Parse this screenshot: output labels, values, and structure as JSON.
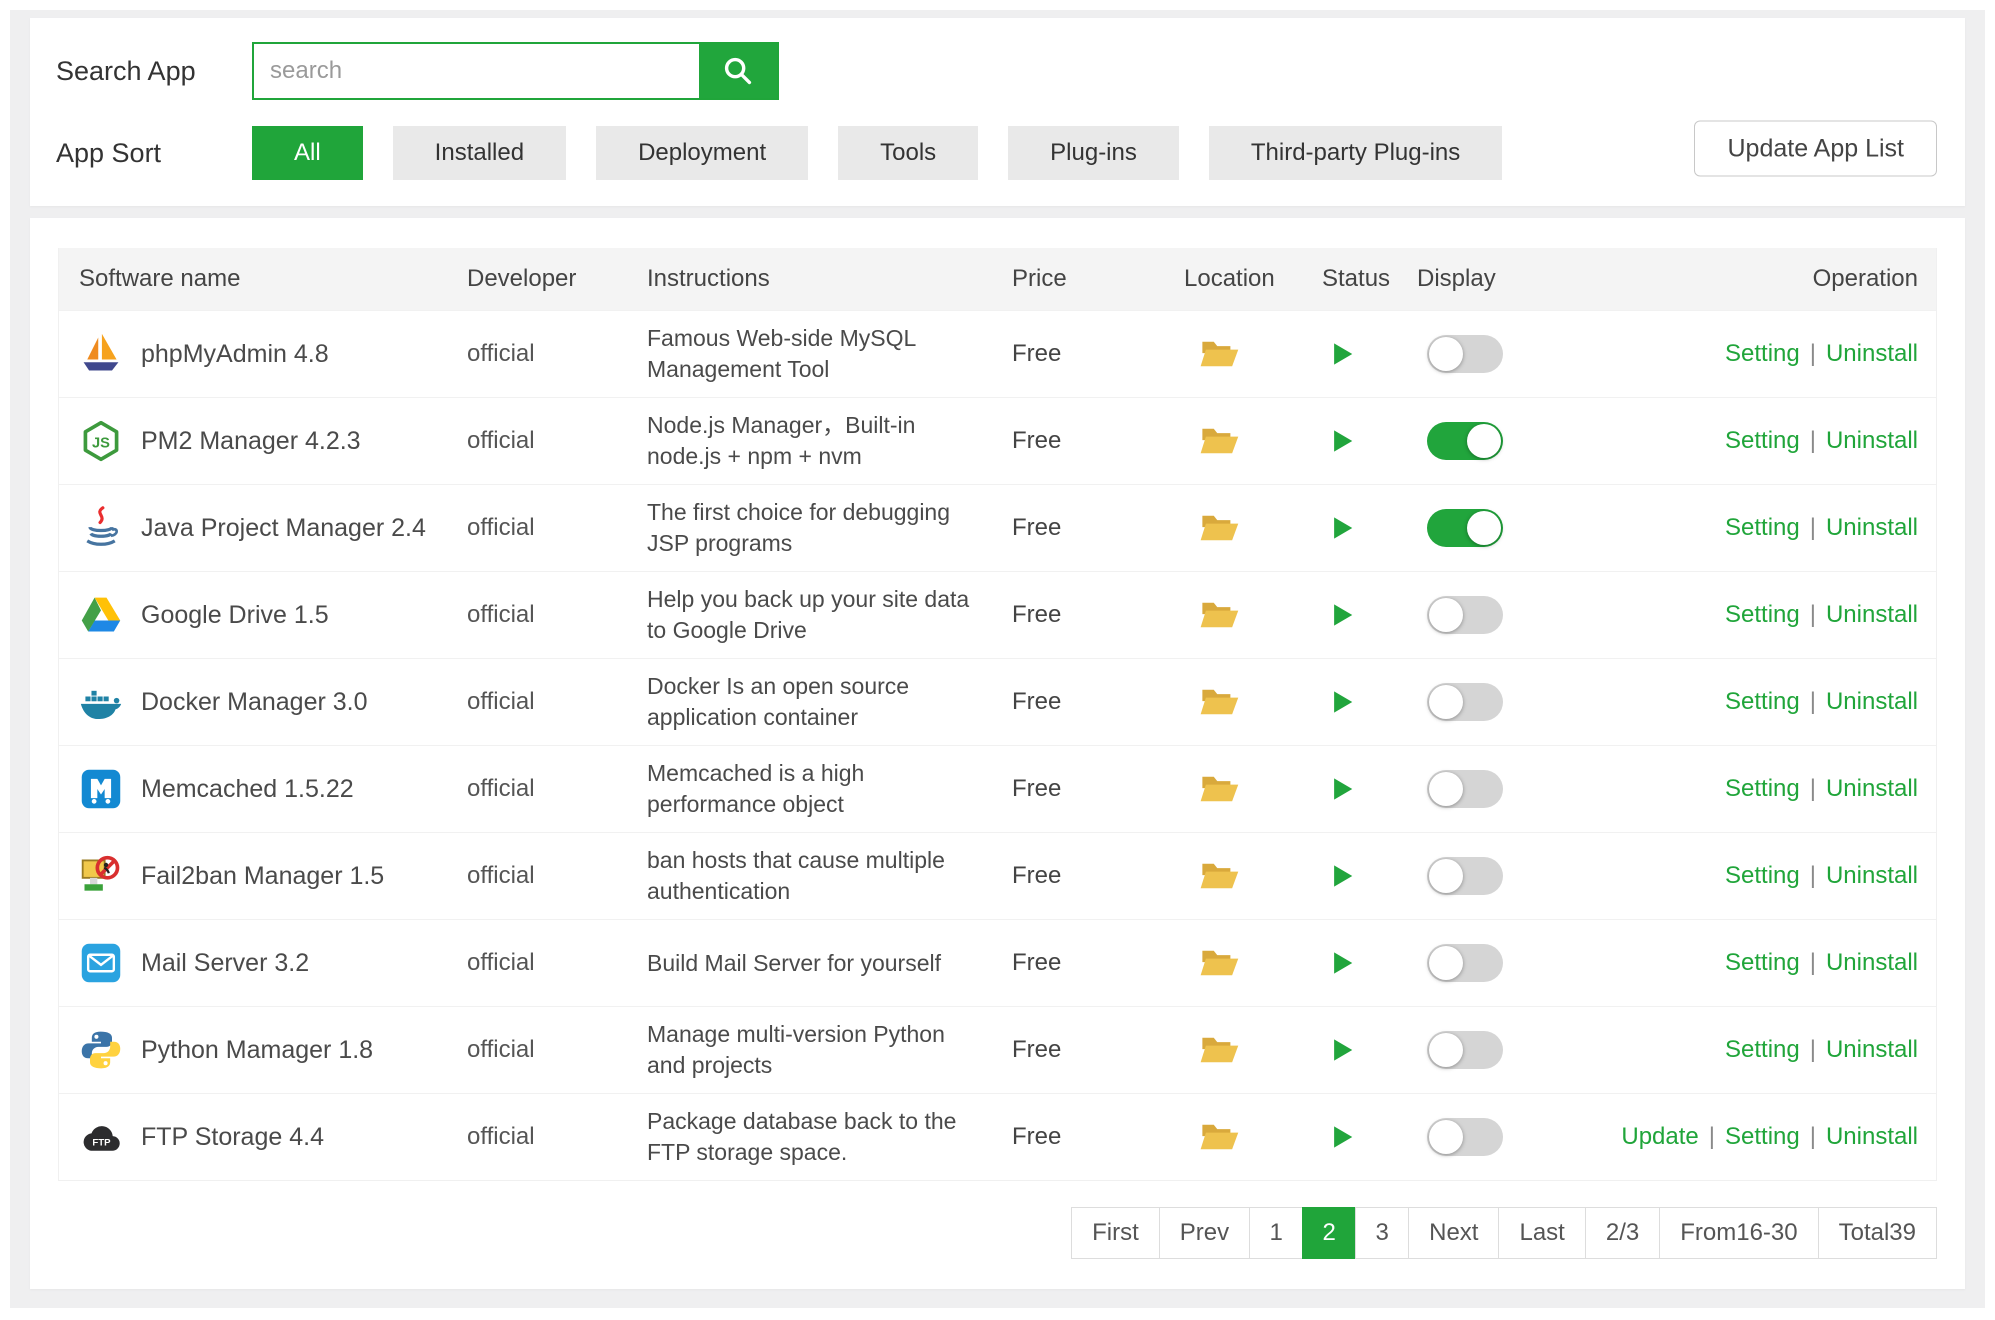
{
  "accent_color": "#20a53a",
  "search": {
    "label": "Search App",
    "placeholder": "search"
  },
  "sort": {
    "label": "App Sort",
    "active": "All",
    "options": [
      "All",
      "Installed",
      "Deployment",
      "Tools",
      "Plug-ins",
      "Third-party Plug-ins"
    ]
  },
  "update_button_label": "Update App List",
  "table": {
    "headers": [
      "Software name",
      "Developer",
      "Instructions",
      "Price",
      "Location",
      "Status",
      "Display",
      "Operation"
    ],
    "location_icon": "folder-icon",
    "status_icon": "play-icon",
    "rows": [
      {
        "icon": "phpmyadmin-icon",
        "name": "phpMyAdmin 4.8",
        "developer": "official",
        "instructions": "Famous Web-side MySQL Management Tool",
        "price": "Free",
        "display_on": false,
        "operations": [
          "Setting",
          "Uninstall"
        ]
      },
      {
        "icon": "pm2-icon",
        "name": "PM2 Manager 4.2.3",
        "developer": "official",
        "instructions": "Node.js Manager，Built-in node.js + npm + nvm",
        "price": "Free",
        "display_on": true,
        "operations": [
          "Setting",
          "Uninstall"
        ]
      },
      {
        "icon": "java-icon",
        "name": "Java Project Manager 2.4",
        "developer": "official",
        "instructions": "The first choice for debugging JSP programs",
        "price": "Free",
        "display_on": true,
        "operations": [
          "Setting",
          "Uninstall"
        ]
      },
      {
        "icon": "google-drive-icon",
        "name": "Google Drive 1.5",
        "developer": "official",
        "instructions": "Help you back up your site data to Google Drive",
        "price": "Free",
        "display_on": false,
        "operations": [
          "Setting",
          "Uninstall"
        ]
      },
      {
        "icon": "docker-icon",
        "name": "Docker Manager 3.0",
        "developer": "official",
        "instructions": "Docker Is an open source application container",
        "price": "Free",
        "display_on": false,
        "operations": [
          "Setting",
          "Uninstall"
        ]
      },
      {
        "icon": "memcached-icon",
        "name": "Memcached 1.5.22",
        "developer": "official",
        "instructions": "Memcached is a high performance object",
        "price": "Free",
        "display_on": false,
        "operations": [
          "Setting",
          "Uninstall"
        ]
      },
      {
        "icon": "fail2ban-icon",
        "name": "Fail2ban Manager 1.5",
        "developer": "official",
        "instructions": "ban hosts that cause multiple authentication",
        "price": "Free",
        "display_on": false,
        "operations": [
          "Setting",
          "Uninstall"
        ]
      },
      {
        "icon": "mail-icon",
        "name": "Mail Server 3.2",
        "developer": "official",
        "instructions": "Build Mail Server for yourself",
        "price": "Free",
        "display_on": false,
        "operations": [
          "Setting",
          "Uninstall"
        ]
      },
      {
        "icon": "python-icon",
        "name": "Python Mamager 1.8",
        "developer": "official",
        "instructions": "Manage multi-version Python and projects",
        "price": "Free",
        "display_on": false,
        "operations": [
          "Setting",
          "Uninstall"
        ]
      },
      {
        "icon": "ftp-icon",
        "name": "FTP Storage 4.4",
        "developer": "official",
        "instructions": "Package database back to the FTP storage space.",
        "price": "Free",
        "display_on": false,
        "operations": [
          "Update",
          "Setting",
          "Uninstall"
        ]
      }
    ]
  },
  "pagination": {
    "active": "2",
    "items": [
      "First",
      "Prev",
      "1",
      "2",
      "3",
      "Next",
      "Last",
      "2/3",
      "From16-30",
      "Total39"
    ],
    "info_items": [
      "2/3",
      "From16-30",
      "Total39"
    ]
  }
}
